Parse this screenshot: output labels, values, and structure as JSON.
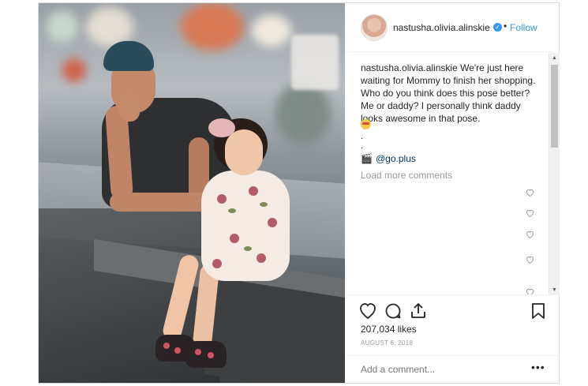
{
  "post": {
    "username": "nastusha.olivia.alinskie",
    "verified_icon": "verified-badge-icon",
    "separator": "•",
    "follow_label": "Follow",
    "caption_user": "nastusha.olivia.alinskie",
    "caption_text": "We're just here waiting for Mommy to finish her shopping. Who do you think does this pose better? Me or daddy? I personally think daddy looks awesome in that pose.",
    "caption_dot_1": ".",
    "caption_dot_2": ".",
    "credit_icon": "🎬",
    "credit_handle": "@go.plus",
    "load_more": "Load more comments",
    "likes": "207,034 likes",
    "date": "AUGUST 6, 2018",
    "add_comment_placeholder": "Add a comment...",
    "more_label": "•••"
  },
  "colors": {
    "link_blue": "#3897f0",
    "text": "#262626",
    "muted": "#999999"
  },
  "icons": {
    "like": "heart-icon",
    "comment": "comment-bubble-icon",
    "share": "share-icon",
    "save": "bookmark-icon",
    "comment_like": "small-heart-icon"
  }
}
